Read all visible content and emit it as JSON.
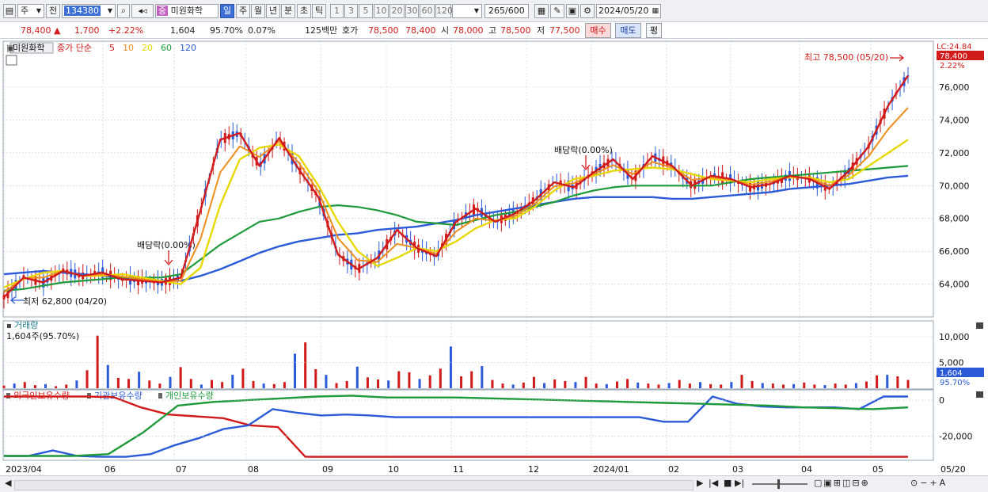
{
  "toolbar": {
    "mode_label": "주",
    "prev_label": "전",
    "code": "134380",
    "name_badge": "중",
    "name": "미원화학",
    "periods": [
      "일",
      "주",
      "월",
      "년",
      "분",
      "초",
      "틱"
    ],
    "active_period": "일",
    "intervals": [
      "1",
      "3",
      "5",
      "10",
      "20",
      "30",
      "60",
      "120"
    ],
    "count": "265",
    "count_total": "/600",
    "date": "2024/05/20"
  },
  "quote": {
    "price": "78,400",
    "arrow": "▲",
    "change": "1,700",
    "change_pct": "+2.22%",
    "volume": "1,604",
    "vol_ratio": "95.70%",
    "turnover": "0.07%",
    "amount": "125백만",
    "hoga_label": "호가",
    "ask": "78,500",
    "bid": "78,400",
    "open_label": "시",
    "open": "78,000",
    "high_label": "고",
    "high": "78,500",
    "low_label": "저",
    "low": "77,500",
    "buy_button": "매수",
    "sell_button": "매도",
    "eval_button": "평"
  },
  "price_panel": {
    "legend_name": "미원화학",
    "legend_main": "종가 단순",
    "ma_labels": [
      {
        "label": "5",
        "color": "#d11a1a"
      },
      {
        "label": "10",
        "color": "#f08c1a"
      },
      {
        "label": "20",
        "color": "#e6d800"
      },
      {
        "label": "60",
        "color": "#1e9a3a"
      },
      {
        "label": "120",
        "color": "#2a5ad8"
      }
    ],
    "high_annotation": "최고 78,500 (05/20)",
    "low_annotation": "최저 62,800 (04/20)",
    "dividend_1": "배당락(0.00%)",
    "dividend_2": "배당락(0.00%)",
    "lc_label": "LC:24.84",
    "current_tag": "78,400",
    "pct_tag": "2.22%",
    "y_ticks": [
      "76,000",
      "74,000",
      "72,000",
      "70,000",
      "68,000",
      "66,000",
      "64,000"
    ]
  },
  "volume_panel": {
    "title": "거래량",
    "value": "1,604주(95.70%)",
    "y_ticks": [
      "10,000",
      "5,000"
    ],
    "current_tag": "1,604",
    "pct_tag": "95.70%"
  },
  "holding_panel": {
    "series": [
      {
        "label": "외국인보유수량",
        "color": "#d11a1a"
      },
      {
        "label": "기관보유수량",
        "color": "#2a5ad8"
      },
      {
        "label": "개인보유수량",
        "color": "#1e9a3a"
      }
    ],
    "y_ticks": [
      "0",
      "-20,000"
    ]
  },
  "x_axis": {
    "labels": [
      "2023/04",
      "06",
      "07",
      "08",
      "09",
      "10",
      "11",
      "12",
      "2024/01",
      "02",
      "03",
      "04",
      "05"
    ],
    "right_label": "05/20"
  },
  "colors": {
    "up": "#d11a1a",
    "down": "#2a5ad8",
    "grid": "#c8d0dc"
  },
  "chart_data": [
    {
      "type": "line",
      "title": "미원화학 종가 단순",
      "y_range": [
        62000,
        78800
      ],
      "series": [
        {
          "name": "5",
          "values": [
            63200,
            64400,
            64100,
            64800,
            64500,
            64700,
            64300,
            64200,
            64100,
            64400,
            68500,
            72800,
            73200,
            71200,
            72900,
            71000,
            69300,
            65800,
            64900,
            65600,
            67300,
            66200,
            65700,
            67800,
            68600,
            67800,
            68300,
            69100,
            70200,
            69900,
            70800,
            71600,
            70400,
            71800,
            71200,
            70000,
            70600,
            70400,
            69900,
            70100,
            70600,
            70400,
            69800,
            70900,
            72400,
            74900,
            76700
          ]
        },
        {
          "name": "20",
          "values": [
            63800,
            64300,
            64700,
            64800,
            64500,
            64500,
            64600,
            64400,
            64200,
            64000,
            65000,
            68800,
            71600,
            72300,
            72500,
            71800,
            70000,
            67800,
            66000,
            65100,
            65600,
            66200,
            66000,
            66600,
            67400,
            67900,
            68000,
            68700,
            69700,
            70400,
            70600,
            70900,
            71000,
            71100,
            71000,
            70700,
            70400,
            70300,
            70200,
            70400,
            70500,
            70500,
            70200,
            70400,
            71200,
            72000,
            72800
          ]
        },
        {
          "name": "60",
          "values": [
            63600,
            63700,
            63900,
            64100,
            64200,
            64300,
            64400,
            64400,
            64400,
            64600,
            65500,
            66400,
            67100,
            67800,
            68000,
            68400,
            68700,
            68800,
            68700,
            68500,
            68200,
            67800,
            67700,
            67600,
            67900,
            68200,
            68400,
            68700,
            69000,
            69400,
            69700,
            69900,
            70000,
            70000,
            70000,
            70000,
            70000,
            70200,
            70400,
            70500,
            70600,
            70700,
            70800,
            70900,
            71000,
            71100,
            71200
          ]
        },
        {
          "name": "120",
          "values": [
            64600,
            64700,
            64800,
            64700,
            64600,
            64500,
            64400,
            64300,
            64200,
            64200,
            64500,
            64900,
            65400,
            65900,
            66300,
            66600,
            66800,
            67000,
            67100,
            67300,
            67400,
            67500,
            67700,
            67900,
            68200,
            68400,
            68600,
            68800,
            69000,
            69200,
            69300,
            69300,
            69300,
            69300,
            69200,
            69200,
            69300,
            69400,
            69500,
            69600,
            69800,
            69900,
            70000,
            70100,
            70300,
            70500,
            70600
          ]
        }
      ],
      "annotations": {
        "high": 78500,
        "high_date": "05/20",
        "low": 62800,
        "low_date": "04/20"
      }
    },
    {
      "type": "bar",
      "title": "거래량",
      "y_range": [
        0,
        12000
      ],
      "values": [
        500,
        900,
        1200,
        600,
        800,
        400,
        700,
        1500,
        3500,
        10200,
        4500,
        2000,
        1800,
        3200,
        1500,
        900,
        2200,
        4100,
        1800,
        700,
        1600,
        1200,
        2600,
        3800,
        1400,
        900,
        800,
        1200,
        6700,
        8900,
        3700,
        2600,
        1000,
        1400,
        4200,
        2100,
        1700,
        1500,
        3300,
        3100,
        1800,
        2500,
        3800,
        8100,
        2300,
        3300,
        4300,
        1600,
        900,
        700,
        1100,
        2200,
        1000,
        1700,
        1400,
        1200,
        2200,
        900,
        800,
        1300,
        1800,
        1100,
        900,
        700,
        1000,
        1600,
        900,
        1200,
        800,
        700,
        1200,
        2600,
        1400,
        1000,
        900,
        700,
        800,
        1100,
        700,
        600,
        900,
        700,
        1000,
        1300,
        2500,
        2600,
        2300,
        1604
      ]
    },
    {
      "type": "line",
      "title": "보유수량",
      "y_range": [
        -33000,
        4000
      ],
      "series": [
        {
          "name": "외국인보유수량",
          "values": [
            2000,
            2000,
            2000,
            2000,
            1700,
            -4000,
            -8000,
            -9000,
            -10000,
            -14000,
            -15000,
            -31500,
            -31500,
            -31500,
            -31500,
            -31500,
            -31500,
            -31500,
            -31500,
            -31500,
            -31500,
            -31500,
            -31500,
            -31500,
            -31500,
            -31500,
            -31500,
            -31500,
            -31500,
            -31500,
            -31500,
            -31500,
            -31500,
            -31500
          ]
        },
        {
          "name": "기관보유수량",
          "values": [
            -31000,
            -31000,
            -28000,
            -31000,
            -31500,
            -31500,
            -30000,
            -25000,
            -21000,
            -16000,
            -14000,
            -5000,
            -7000,
            -8500,
            -8000,
            -8500,
            -9500,
            -9500,
            -9500,
            -9500,
            -9500,
            -9500,
            -9500,
            -9500,
            -9500,
            -9500,
            -9500,
            -12000,
            -12000,
            2000,
            -2000,
            -3500,
            -4000,
            -4000,
            -4000,
            -5000,
            2000,
            2000
          ]
        },
        {
          "name": "개인보유수량",
          "values": [
            -31000,
            -31000,
            -31000,
            -30000,
            -18000,
            -3000,
            -1000,
            0,
            1000,
            2000,
            2500,
            1500,
            1500,
            1500,
            1000,
            500,
            0,
            -500,
            -1000,
            -1500,
            -2000,
            -2500,
            -3000,
            -4000,
            -4500,
            -5000,
            -4000
          ]
        }
      ]
    }
  ]
}
